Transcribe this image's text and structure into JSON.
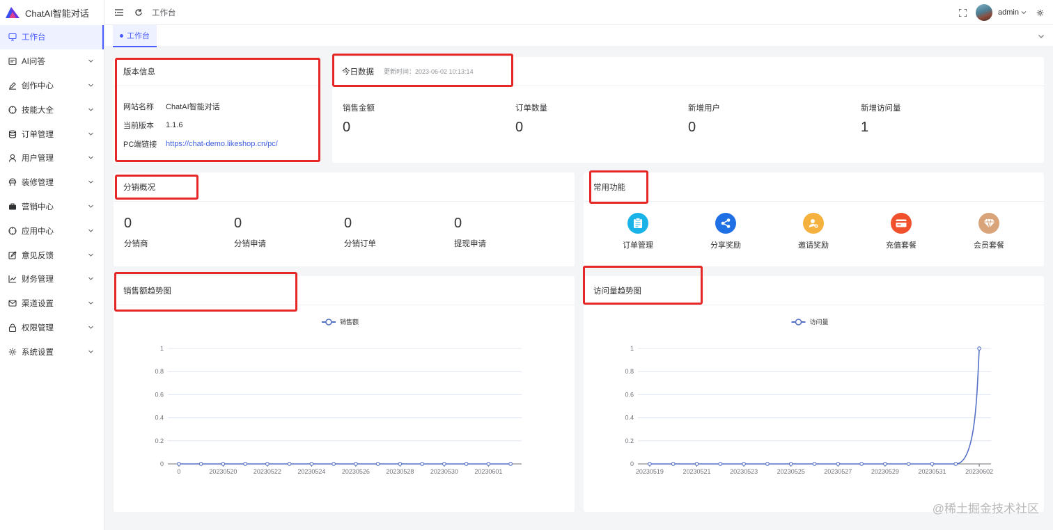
{
  "app": {
    "title": "ChatAI智能对话"
  },
  "header": {
    "breadcrumb": "工作台",
    "username": "admin"
  },
  "sidebar": {
    "items": [
      {
        "label": "工作台",
        "icon": "monitor-icon",
        "active": true
      },
      {
        "label": "AI问答",
        "icon": "chat-icon"
      },
      {
        "label": "创作中心",
        "icon": "pen-icon"
      },
      {
        "label": "技能大全",
        "icon": "compass-icon"
      },
      {
        "label": "订单管理",
        "icon": "database-icon"
      },
      {
        "label": "用户管理",
        "icon": "user-icon"
      },
      {
        "label": "装修管理",
        "icon": "palette-icon"
      },
      {
        "label": "营销中心",
        "icon": "briefcase-icon"
      },
      {
        "label": "应用中心",
        "icon": "compass-icon"
      },
      {
        "label": "意见反馈",
        "icon": "edit-icon"
      },
      {
        "label": "财务管理",
        "icon": "chart-icon"
      },
      {
        "label": "渠道设置",
        "icon": "mail-icon"
      },
      {
        "label": "权限管理",
        "icon": "lock-icon"
      },
      {
        "label": "系统设置",
        "icon": "gear-icon"
      }
    ]
  },
  "tabs": [
    {
      "label": "工作台"
    }
  ],
  "version": {
    "title": "版本信息",
    "site_name_label": "网站名称",
    "site_name": "ChatAI智能对话",
    "version_label": "当前版本",
    "version": "1.1.6",
    "pc_link_label": "PC端链接",
    "pc_link": "https://chat-demo.likeshop.cn/pc/"
  },
  "today": {
    "title": "今日数据",
    "updated": "更新时间：2023-06-02 10:13:14",
    "stats": [
      {
        "label": "销售金额",
        "value": "0"
      },
      {
        "label": "订单数量",
        "value": "0"
      },
      {
        "label": "新增用户",
        "value": "0"
      },
      {
        "label": "新增访问量",
        "value": "1"
      }
    ]
  },
  "distribution": {
    "title": "分销概况",
    "stats": [
      {
        "label": "分销商",
        "value": "0"
      },
      {
        "label": "分销申请",
        "value": "0"
      },
      {
        "label": "分销订单",
        "value": "0"
      },
      {
        "label": "提现申请",
        "value": "0"
      }
    ]
  },
  "functions": {
    "title": "常用功能",
    "items": [
      {
        "label": "订单管理",
        "icon": "clipboard-icon",
        "color": "#1ab3e8"
      },
      {
        "label": "分享奖励",
        "icon": "share-icon",
        "color": "#1f6fe5"
      },
      {
        "label": "邀请奖励",
        "icon": "invite-icon",
        "color": "#f5b13d"
      },
      {
        "label": "充值套餐",
        "icon": "card-icon",
        "color": "#f0502b"
      },
      {
        "label": "会员套餐",
        "icon": "diamond-icon",
        "color": "#d9a47a"
      }
    ]
  },
  "colors": {
    "accent": "#4a5dff",
    "line": "#5470c6",
    "highlight": "#e52727"
  },
  "charts": {
    "sales": {
      "title": "销售额趋势图"
    },
    "visits": {
      "title": "访问量趋势图"
    }
  },
  "chart_data": [
    {
      "type": "line",
      "title": "销售额趋势图",
      "legend": "销售额",
      "ylim": [
        0,
        1
      ],
      "yticks": [
        "0",
        "0.2",
        "0.4",
        "0.6",
        "0.8",
        "1"
      ],
      "xtick_labels": [
        "0",
        "20230520",
        "20230522",
        "20230524",
        "20230526",
        "20230528",
        "20230530",
        "20230601"
      ],
      "x": [
        "0",
        "20230519",
        "20230520",
        "20230521",
        "20230522",
        "20230523",
        "20230524",
        "20230525",
        "20230526",
        "20230527",
        "20230528",
        "20230529",
        "20230530",
        "20230531",
        "20230601",
        "20230602"
      ],
      "series": [
        {
          "name": "销售额",
          "values": [
            0,
            0,
            0,
            0,
            0,
            0,
            0,
            0,
            0,
            0,
            0,
            0,
            0,
            0,
            0,
            0
          ]
        }
      ]
    },
    {
      "type": "line",
      "title": "访问量趋势图",
      "legend": "访问量",
      "ylim": [
        0,
        1
      ],
      "yticks": [
        "0",
        "0.2",
        "0.4",
        "0.6",
        "0.8",
        "1"
      ],
      "xtick_labels": [
        "20230519",
        "20230521",
        "20230523",
        "20230525",
        "20230527",
        "20230529",
        "20230531",
        "20230602"
      ],
      "x": [
        "20230519",
        "20230520",
        "20230521",
        "20230522",
        "20230523",
        "20230524",
        "20230525",
        "20230526",
        "20230527",
        "20230528",
        "20230529",
        "20230530",
        "20230531",
        "20230601",
        "20230602"
      ],
      "series": [
        {
          "name": "访问量",
          "values": [
            0,
            0,
            0,
            0,
            0,
            0,
            0,
            0,
            0,
            0,
            0,
            0,
            0,
            0,
            1
          ]
        }
      ]
    }
  ],
  "watermark": "@稀土掘金技术社区"
}
